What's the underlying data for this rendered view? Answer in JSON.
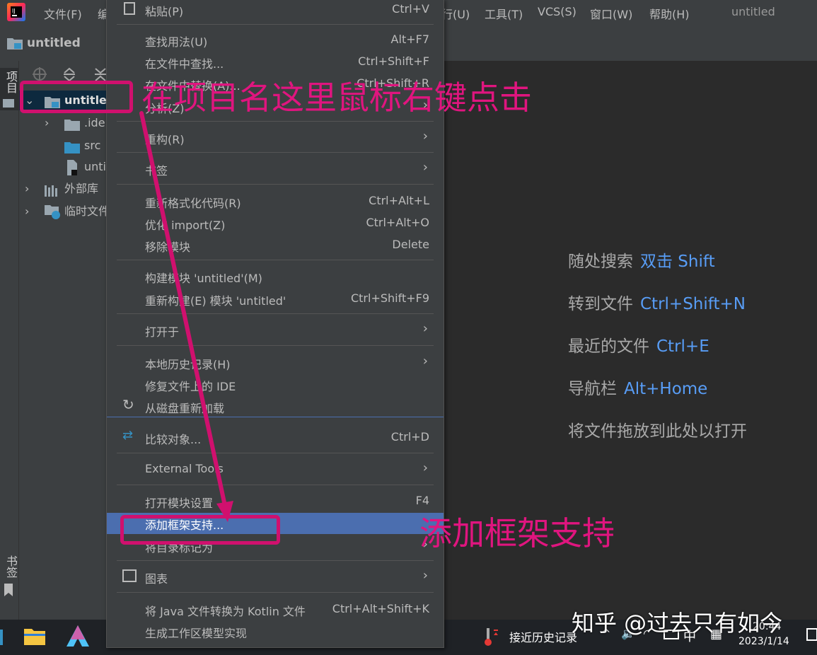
{
  "window": {
    "title": "untitled"
  },
  "menubar": {
    "items": [
      "文件(F)",
      "编",
      "行(U)",
      "工具(T)",
      "VCS(S)",
      "窗口(W)",
      "帮助(H)"
    ]
  },
  "navbar": {
    "project": "untitled"
  },
  "left_stripe": {
    "project_tab": "项目",
    "bookmarks_tab": "书签"
  },
  "project_tree": {
    "items": [
      {
        "label": "untitled",
        "icon": "folder-module-icon"
      },
      {
        "label": ".ide",
        "icon": "folder-icon"
      },
      {
        "label": "src",
        "icon": "folder-src-icon"
      },
      {
        "label": "unti",
        "icon": "file-icon"
      },
      {
        "label": "外部库",
        "icon": "library-icon"
      },
      {
        "label": "临时文件",
        "icon": "scratch-icon"
      }
    ]
  },
  "context_menu": {
    "items": [
      {
        "label": "粘贴(P)",
        "shortcut": "Ctrl+V"
      },
      {
        "label": "查找用法(U)",
        "shortcut": "Alt+F7"
      },
      {
        "label": "在文件中查找...",
        "shortcut": "Ctrl+Shift+F"
      },
      {
        "label": "在文件中替换(A)...",
        "shortcut": "Ctrl+Shift+R"
      },
      {
        "label": "分析(Z)",
        "shortcut": ""
      },
      {
        "label": "重构(R)",
        "shortcut": ""
      },
      {
        "label": "书签",
        "shortcut": ""
      },
      {
        "label": "重新格式化代码(R)",
        "shortcut": "Ctrl+Alt+L"
      },
      {
        "label": "优化 import(Z)",
        "shortcut": "Ctrl+Alt+O"
      },
      {
        "label": "移除模块",
        "shortcut": "Delete"
      },
      {
        "label": "构建模块 'untitled'(M)",
        "shortcut": ""
      },
      {
        "label": "重新构建(E) 模块 'untitled'",
        "shortcut": "Ctrl+Shift+F9"
      },
      {
        "label": "打开于",
        "shortcut": ""
      },
      {
        "label": "本地历史记录(H)",
        "shortcut": ""
      },
      {
        "label": "修复文件上的 IDE",
        "shortcut": ""
      },
      {
        "label": "从磁盘重新加载",
        "shortcut": ""
      },
      {
        "label": "比较对象...",
        "shortcut": "Ctrl+D"
      },
      {
        "label": "External Tools",
        "shortcut": ""
      },
      {
        "label": "打开模块设置",
        "shortcut": "F4"
      },
      {
        "label": "添加框架支持...",
        "shortcut": ""
      },
      {
        "label": "将目录标记为",
        "shortcut": ""
      },
      {
        "label": "图表",
        "shortcut": ""
      },
      {
        "label": "将 Java 文件转换为 Kotlin 文件",
        "shortcut": "Ctrl+Alt+Shift+K"
      },
      {
        "label": "生成工作区模型实现",
        "shortcut": ""
      }
    ]
  },
  "editor_hints": {
    "items": [
      {
        "text": "随处搜索",
        "key": "双击 Shift"
      },
      {
        "text": "转到文件",
        "key": "Ctrl+Shift+N"
      },
      {
        "text": "最近的文件",
        "key": "Ctrl+E"
      },
      {
        "text": "导航栏",
        "key": "Alt+Home"
      },
      {
        "text": "将文件拖放到此处以打开",
        "key": ""
      }
    ]
  },
  "annotations": {
    "right_click_hint": "在项目名这里鼠标右键点击",
    "add_framework_hint": "添加框架支持",
    "color": "#e0157f"
  },
  "taskbar": {
    "notification": "接近历史记录",
    "ime": "中",
    "time": "20:44",
    "date": "2023/1/14"
  },
  "watermark": "知乎 @过去只有如今",
  "colors": {
    "menu_bg": "#3c3f41",
    "editor_bg": "#2b2b2b",
    "selection": "#4b6eaf",
    "hint_key": "#589df6"
  }
}
